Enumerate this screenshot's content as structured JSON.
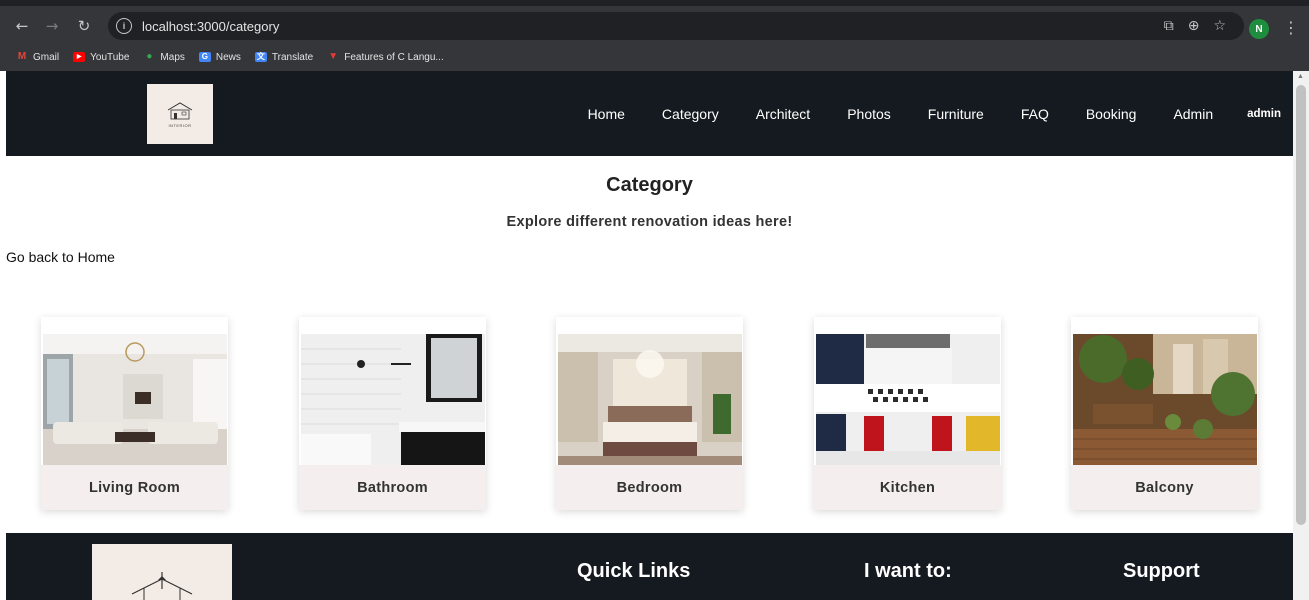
{
  "browser": {
    "url": "localhost:3000/category",
    "profile_initial": "N",
    "bookmarks": [
      {
        "label": "Gmail",
        "color": "#ea4335",
        "glyph": "M"
      },
      {
        "label": "YouTube",
        "color": "#ff0000",
        "glyph": "▶"
      },
      {
        "label": "Maps",
        "color": "#34a853",
        "glyph": "●"
      },
      {
        "label": "News",
        "color": "#4285f4",
        "glyph": "G"
      },
      {
        "label": "Translate",
        "color": "#4285f4",
        "glyph": "文"
      },
      {
        "label": "Features of C Langu...",
        "color": "#e53935",
        "glyph": "▼"
      }
    ]
  },
  "header": {
    "logo_text": "INTERIOR",
    "nav": [
      "Home",
      "Category",
      "Architect",
      "Photos",
      "Furniture",
      "FAQ",
      "Booking",
      "Admin"
    ],
    "user": "admin"
  },
  "main": {
    "title": "Category",
    "subtitle": "Explore different renovation ideas here!",
    "back_link": "Go back to Home",
    "categories": [
      {
        "label": "Living Room",
        "icon": "living-room-photo"
      },
      {
        "label": "Bathroom",
        "icon": "bathroom-photo"
      },
      {
        "label": "Bedroom",
        "icon": "bedroom-photo"
      },
      {
        "label": "Kitchen",
        "icon": "kitchen-photo"
      },
      {
        "label": "Balcony",
        "icon": "balcony-photo"
      }
    ]
  },
  "footer": {
    "quick_links": "Quick Links",
    "i_want_to": "I want to:",
    "support": "Support"
  },
  "colors": {
    "header_bg": "#141a1f",
    "card_band": "#f4eeee",
    "logo_bg": "#f2ebe6"
  }
}
